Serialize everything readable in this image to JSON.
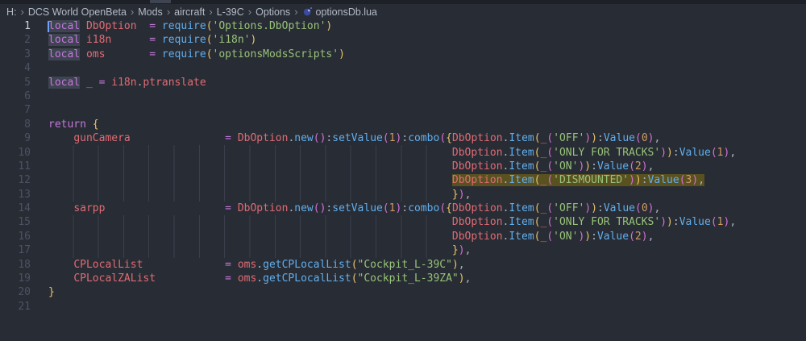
{
  "breadcrumb": {
    "items": [
      "H:",
      "DCS World OpenBeta",
      "Mods",
      "aircraft",
      "L-39C",
      "Options"
    ],
    "file": "optionsDb.lua",
    "separator": "›",
    "file_icon": "lua-file-icon"
  },
  "theme": {
    "bg": "#282c34",
    "kw": "#c678dd",
    "vr": "#e06c75",
    "fn": "#61afef",
    "st": "#98c379",
    "nu": "#d19a66",
    "pu": "#abb2bf",
    "op": "#c678dd",
    "b1": "#e9c46a",
    "b2": "#d670d6",
    "wordHl": "#3e4451",
    "selBg": "#5a5120",
    "cursor": "#6ea1f7",
    "lineNum": "#4b5364",
    "lineNumActive": "#ccd2dd",
    "breadcrumbText": "#b3bac6",
    "guide": "#3a3f4b"
  },
  "editor": {
    "active_line": 1,
    "lines": [
      {
        "num": 1,
        "segs": [
          {
            "t": "local",
            "c": "kw",
            "h": 1,
            "cur": 1
          },
          {
            "sp": 1
          },
          {
            "t": "DbOption",
            "c": "vr"
          },
          {
            "sp": 2
          },
          {
            "t": "=",
            "c": "op"
          },
          {
            "sp": 1
          },
          {
            "t": "require",
            "c": "fn"
          },
          {
            "t": "(",
            "c": "b1"
          },
          {
            "t": "'Options.DbOption'",
            "c": "st"
          },
          {
            "t": ")",
            "c": "b1"
          }
        ]
      },
      {
        "num": 2,
        "segs": [
          {
            "t": "local",
            "c": "kw",
            "h": 1
          },
          {
            "sp": 1
          },
          {
            "t": "i18n",
            "c": "vr"
          },
          {
            "sp": 6
          },
          {
            "t": "=",
            "c": "op"
          },
          {
            "sp": 1
          },
          {
            "t": "require",
            "c": "fn"
          },
          {
            "t": "(",
            "c": "b1"
          },
          {
            "t": "'i18n'",
            "c": "st"
          },
          {
            "t": ")",
            "c": "b1"
          }
        ]
      },
      {
        "num": 3,
        "segs": [
          {
            "t": "local",
            "c": "kw",
            "h": 1
          },
          {
            "sp": 1
          },
          {
            "t": "oms",
            "c": "vr"
          },
          {
            "sp": 7
          },
          {
            "t": "=",
            "c": "op"
          },
          {
            "sp": 1
          },
          {
            "t": "require",
            "c": "fn"
          },
          {
            "t": "(",
            "c": "b1"
          },
          {
            "t": "'optionsModsScripts'",
            "c": "st"
          },
          {
            "t": ")",
            "c": "b1"
          }
        ]
      },
      {
        "num": 4,
        "segs": []
      },
      {
        "num": 5,
        "segs": [
          {
            "t": "local",
            "c": "kw",
            "h": 1
          },
          {
            "sp": 1
          },
          {
            "t": "_",
            "c": "vr"
          },
          {
            "sp": 1
          },
          {
            "t": "=",
            "c": "op"
          },
          {
            "sp": 1
          },
          {
            "t": "i18n",
            "c": "vr"
          },
          {
            "t": ".",
            "c": "pu"
          },
          {
            "t": "ptranslate",
            "c": "vr"
          }
        ]
      },
      {
        "num": 6,
        "segs": []
      },
      {
        "num": 7,
        "segs": []
      },
      {
        "num": 8,
        "segs": [
          {
            "t": "return",
            "c": "kw"
          },
          {
            "sp": 1
          },
          {
            "t": "{",
            "c": "b1"
          }
        ]
      },
      {
        "num": 9,
        "segs": [
          {
            "sp": 4
          },
          {
            "t": "gunCamera",
            "c": "vr"
          },
          {
            "sp": 15
          },
          {
            "t": "=",
            "c": "op"
          },
          {
            "sp": 1
          },
          {
            "t": "DbOption",
            "c": "vr"
          },
          {
            "t": ".",
            "c": "pu"
          },
          {
            "t": "new",
            "c": "fn"
          },
          {
            "t": "()",
            "c": "b2"
          },
          {
            "t": ":",
            "c": "pu"
          },
          {
            "t": "setValue",
            "c": "fn"
          },
          {
            "t": "(",
            "c": "b2"
          },
          {
            "t": "1",
            "c": "nu"
          },
          {
            "t": ")",
            "c": "b2"
          },
          {
            "t": ":",
            "c": "pu"
          },
          {
            "t": "combo",
            "c": "fn"
          },
          {
            "t": "(",
            "c": "b2"
          },
          {
            "t": "{",
            "c": "b1"
          },
          {
            "t": "DbOption",
            "c": "vr"
          },
          {
            "t": ".",
            "c": "pu"
          },
          {
            "t": "Item",
            "c": "fn"
          },
          {
            "t": "(",
            "c": "b1"
          },
          {
            "t": "_",
            "c": "vr"
          },
          {
            "t": "(",
            "c": "b2"
          },
          {
            "t": "'OFF'",
            "c": "st"
          },
          {
            "t": ")",
            "c": "b2"
          },
          {
            "t": ")",
            "c": "b1"
          },
          {
            "t": ":",
            "c": "pu"
          },
          {
            "t": "Value",
            "c": "fn"
          },
          {
            "t": "(",
            "c": "b2"
          },
          {
            "t": "0",
            "c": "nu"
          },
          {
            "t": ")",
            "c": "b2"
          },
          {
            "t": ",",
            "c": "pu"
          }
        ]
      },
      {
        "num": 10,
        "segs": [
          {
            "sp": 64,
            "g": 1
          },
          {
            "t": "DbOption",
            "c": "vr"
          },
          {
            "t": ".",
            "c": "pu"
          },
          {
            "t": "Item",
            "c": "fn"
          },
          {
            "t": "(",
            "c": "b1"
          },
          {
            "t": "_",
            "c": "vr"
          },
          {
            "t": "(",
            "c": "b2"
          },
          {
            "t": "'ONLY FOR TRACKS'",
            "c": "st"
          },
          {
            "t": ")",
            "c": "b2"
          },
          {
            "t": ")",
            "c": "b1"
          },
          {
            "t": ":",
            "c": "pu"
          },
          {
            "t": "Value",
            "c": "fn"
          },
          {
            "t": "(",
            "c": "b2"
          },
          {
            "t": "1",
            "c": "nu"
          },
          {
            "t": ")",
            "c": "b2"
          },
          {
            "t": ",",
            "c": "pu"
          }
        ]
      },
      {
        "num": 11,
        "segs": [
          {
            "sp": 64,
            "g": 1
          },
          {
            "t": "DbOption",
            "c": "vr"
          },
          {
            "t": ".",
            "c": "pu"
          },
          {
            "t": "Item",
            "c": "fn"
          },
          {
            "t": "(",
            "c": "b1"
          },
          {
            "t": "_",
            "c": "vr"
          },
          {
            "t": "(",
            "c": "b2"
          },
          {
            "t": "'ON'",
            "c": "st"
          },
          {
            "t": ")",
            "c": "b2"
          },
          {
            "t": ")",
            "c": "b1"
          },
          {
            "t": ":",
            "c": "pu"
          },
          {
            "t": "Value",
            "c": "fn"
          },
          {
            "t": "(",
            "c": "b2"
          },
          {
            "t": "2",
            "c": "nu"
          },
          {
            "t": ")",
            "c": "b2"
          },
          {
            "t": ",",
            "c": "pu"
          }
        ]
      },
      {
        "num": 12,
        "segs": [
          {
            "sp": 64,
            "g": 1
          },
          {
            "t": "DbOption",
            "c": "vr",
            "sel": 1
          },
          {
            "t": ".",
            "c": "pu",
            "sel": 1
          },
          {
            "t": "Item",
            "c": "fn",
            "sel": 1
          },
          {
            "t": "(",
            "c": "b1",
            "sel": 1
          },
          {
            "t": "_",
            "c": "vr",
            "sel": 1
          },
          {
            "t": "(",
            "c": "b2",
            "sel": 1
          },
          {
            "t": "'DISMOUNTED'",
            "c": "st",
            "sel": 1
          },
          {
            "t": ")",
            "c": "b2",
            "sel": 1
          },
          {
            "t": ")",
            "c": "b1",
            "sel": 1
          },
          {
            "t": ":",
            "c": "pu",
            "sel": 1
          },
          {
            "t": "Value",
            "c": "fn",
            "sel": 1
          },
          {
            "t": "(",
            "c": "b2",
            "sel": 1
          },
          {
            "t": "3",
            "c": "nu",
            "sel": 1
          },
          {
            "t": ")",
            "c": "b2",
            "sel": 1
          },
          {
            "t": ",",
            "c": "pu",
            "sel": 1
          }
        ]
      },
      {
        "num": 13,
        "segs": [
          {
            "sp": 64,
            "g": 1
          },
          {
            "t": "}",
            "c": "b1"
          },
          {
            "t": ")",
            "c": "b2"
          },
          {
            "t": ",",
            "c": "pu"
          }
        ]
      },
      {
        "num": 14,
        "segs": [
          {
            "sp": 4
          },
          {
            "t": "sarpp",
            "c": "vr"
          },
          {
            "sp": 19
          },
          {
            "t": "=",
            "c": "op"
          },
          {
            "sp": 1
          },
          {
            "t": "DbOption",
            "c": "vr"
          },
          {
            "t": ".",
            "c": "pu"
          },
          {
            "t": "new",
            "c": "fn"
          },
          {
            "t": "()",
            "c": "b2"
          },
          {
            "t": ":",
            "c": "pu"
          },
          {
            "t": "setValue",
            "c": "fn"
          },
          {
            "t": "(",
            "c": "b2"
          },
          {
            "t": "1",
            "c": "nu"
          },
          {
            "t": ")",
            "c": "b2"
          },
          {
            "t": ":",
            "c": "pu"
          },
          {
            "t": "combo",
            "c": "fn"
          },
          {
            "t": "(",
            "c": "b2"
          },
          {
            "t": "{",
            "c": "b1"
          },
          {
            "t": "DbOption",
            "c": "vr"
          },
          {
            "t": ".",
            "c": "pu"
          },
          {
            "t": "Item",
            "c": "fn"
          },
          {
            "t": "(",
            "c": "b1"
          },
          {
            "t": "_",
            "c": "vr"
          },
          {
            "t": "(",
            "c": "b2"
          },
          {
            "t": "'OFF'",
            "c": "st"
          },
          {
            "t": ")",
            "c": "b2"
          },
          {
            "t": ")",
            "c": "b1"
          },
          {
            "t": ":",
            "c": "pu"
          },
          {
            "t": "Value",
            "c": "fn"
          },
          {
            "t": "(",
            "c": "b2"
          },
          {
            "t": "0",
            "c": "nu"
          },
          {
            "t": ")",
            "c": "b2"
          },
          {
            "t": ",",
            "c": "pu"
          }
        ]
      },
      {
        "num": 15,
        "segs": [
          {
            "sp": 64,
            "g": 1
          },
          {
            "t": "DbOption",
            "c": "vr"
          },
          {
            "t": ".",
            "c": "pu"
          },
          {
            "t": "Item",
            "c": "fn"
          },
          {
            "t": "(",
            "c": "b1"
          },
          {
            "t": "_",
            "c": "vr"
          },
          {
            "t": "(",
            "c": "b2"
          },
          {
            "t": "'ONLY FOR TRACKS'",
            "c": "st"
          },
          {
            "t": ")",
            "c": "b2"
          },
          {
            "t": ")",
            "c": "b1"
          },
          {
            "t": ":",
            "c": "pu"
          },
          {
            "t": "Value",
            "c": "fn"
          },
          {
            "t": "(",
            "c": "b2"
          },
          {
            "t": "1",
            "c": "nu"
          },
          {
            "t": ")",
            "c": "b2"
          },
          {
            "t": ",",
            "c": "pu"
          }
        ]
      },
      {
        "num": 16,
        "segs": [
          {
            "sp": 64,
            "g": 1
          },
          {
            "t": "DbOption",
            "c": "vr"
          },
          {
            "t": ".",
            "c": "pu"
          },
          {
            "t": "Item",
            "c": "fn"
          },
          {
            "t": "(",
            "c": "b1"
          },
          {
            "t": "_",
            "c": "vr"
          },
          {
            "t": "(",
            "c": "b2"
          },
          {
            "t": "'ON'",
            "c": "st"
          },
          {
            "t": ")",
            "c": "b2"
          },
          {
            "t": ")",
            "c": "b1"
          },
          {
            "t": ":",
            "c": "pu"
          },
          {
            "t": "Value",
            "c": "fn"
          },
          {
            "t": "(",
            "c": "b2"
          },
          {
            "t": "2",
            "c": "nu"
          },
          {
            "t": ")",
            "c": "b2"
          },
          {
            "t": ",",
            "c": "pu"
          }
        ]
      },
      {
        "num": 17,
        "segs": [
          {
            "sp": 64,
            "g": 1
          },
          {
            "t": "}",
            "c": "b1"
          },
          {
            "t": ")",
            "c": "b2"
          },
          {
            "t": ",",
            "c": "pu"
          }
        ]
      },
      {
        "num": 18,
        "segs": [
          {
            "sp": 4
          },
          {
            "t": "CPLocalList",
            "c": "vr"
          },
          {
            "sp": 13
          },
          {
            "t": "=",
            "c": "op"
          },
          {
            "sp": 1
          },
          {
            "t": "oms",
            "c": "vr"
          },
          {
            "t": ".",
            "c": "pu"
          },
          {
            "t": "getCPLocalList",
            "c": "fn"
          },
          {
            "t": "(",
            "c": "b1"
          },
          {
            "t": "\"Cockpit_L-39C\"",
            "c": "st"
          },
          {
            "t": ")",
            "c": "b1"
          },
          {
            "t": ",",
            "c": "pu"
          }
        ]
      },
      {
        "num": 19,
        "segs": [
          {
            "sp": 4
          },
          {
            "t": "CPLocalZAList",
            "c": "vr"
          },
          {
            "sp": 11
          },
          {
            "t": "=",
            "c": "op"
          },
          {
            "sp": 1
          },
          {
            "t": "oms",
            "c": "vr"
          },
          {
            "t": ".",
            "c": "pu"
          },
          {
            "t": "getCPLocalList",
            "c": "fn"
          },
          {
            "t": "(",
            "c": "b1"
          },
          {
            "t": "\"Cockpit_L-39ZA\"",
            "c": "st"
          },
          {
            "t": ")",
            "c": "b1"
          },
          {
            "t": ",",
            "c": "pu"
          }
        ]
      },
      {
        "num": 20,
        "segs": [
          {
            "t": "}",
            "c": "b1"
          }
        ]
      },
      {
        "num": 21,
        "segs": []
      }
    ]
  }
}
